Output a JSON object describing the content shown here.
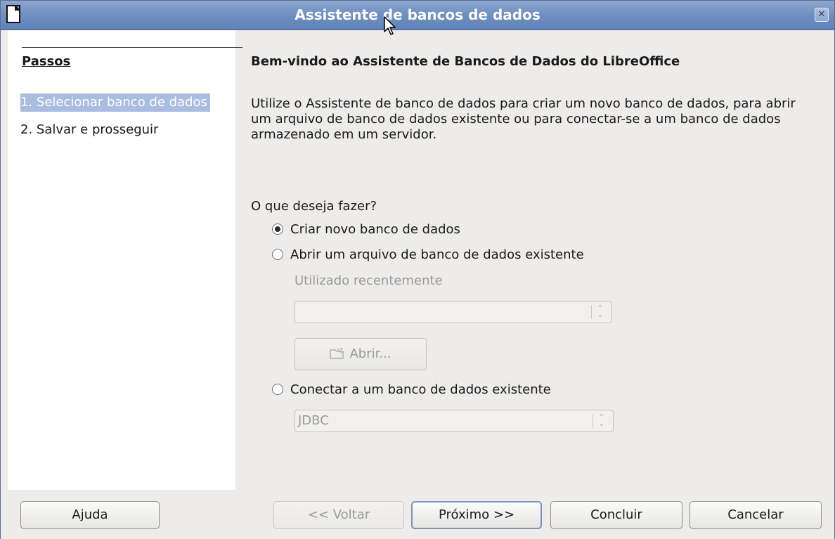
{
  "window": {
    "title": "Assistente de bancos de dados",
    "close_glyph": "✕"
  },
  "sidebar": {
    "heading": "Passos",
    "steps": [
      {
        "label": "1. Selecionar banco de dados",
        "active": true
      },
      {
        "label": "2. Salvar e prosseguir",
        "active": false
      }
    ]
  },
  "main": {
    "welcome": "Bem-vindo ao Assistente de Bancos de Dados do LibreOffice",
    "intro": "Utilize o Assistente de banco de dados para criar um novo banco de dados, para abrir um arquivo de banco de dados existente ou para conectar-se a um banco de dados armazenado em um servidor.",
    "question": "O que deseja fazer?",
    "options": {
      "create": {
        "label": "Criar novo banco de dados",
        "selected": true
      },
      "open": {
        "label": "Abrir um arquivo de banco de dados existente",
        "selected": false
      },
      "connect": {
        "label": "Conectar a um banco de dados existente",
        "selected": false
      }
    },
    "recent_label": "Utilizado recentemente",
    "recent_value": "",
    "open_button": "Abrir...",
    "connection_type": "JDBC"
  },
  "footer": {
    "help": "Ajuda",
    "back": "<< Voltar",
    "next": "Próximo >>",
    "finish": "Concluir",
    "cancel": "Cancelar"
  },
  "icons": {
    "app": "libreoffice-document-icon",
    "close": "close-icon",
    "folder": "folder-open-icon",
    "cursor": "mouse-pointer-icon"
  },
  "colors": {
    "titlebar": "#6f8fc0",
    "selection": "#a8bde0",
    "window_bg": "#edeceb"
  }
}
